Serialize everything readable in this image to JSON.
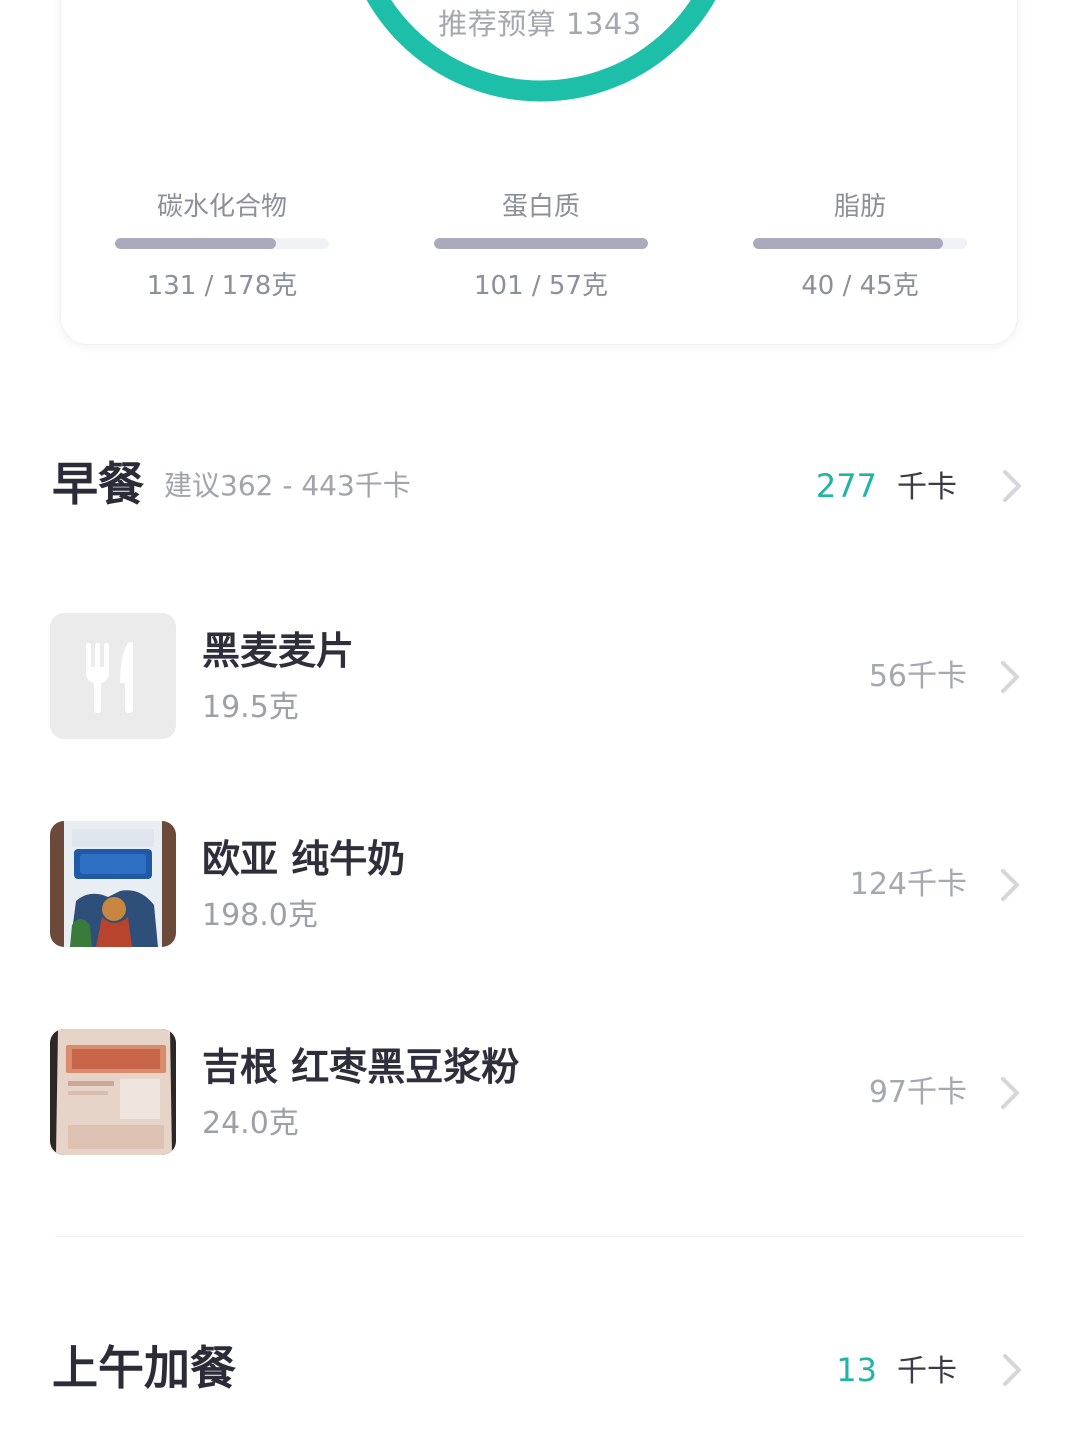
{
  "summary": {
    "budget_label": "推荐预算 1343",
    "ring_color": "#1dbfa9",
    "macros": [
      {
        "label": "碳水化合物",
        "value": "131 / 178克",
        "fill_fraction": 0.75
      },
      {
        "label": "蛋白质",
        "value": "101 / 57克",
        "fill_fraction": 1.0
      },
      {
        "label": "脂肪",
        "value": "40 / 45克",
        "fill_fraction": 0.89
      }
    ]
  },
  "breakfast": {
    "title": "早餐",
    "suggestion": "建议362 - 443千卡",
    "calories": "277",
    "unit": "千卡",
    "items": [
      {
        "name": "黑麦麦片",
        "weight": "19.5克",
        "calories": "56千卡",
        "icon": "utensils-icon"
      },
      {
        "name": "欧亚 纯牛奶",
        "weight": "198.0克",
        "calories": "124千卡",
        "icon": "milk-package-photo"
      },
      {
        "name": "吉根 红枣黑豆浆粉",
        "weight": "24.0克",
        "calories": "97千卡",
        "icon": "soy-powder-package-photo"
      }
    ]
  },
  "morning_snack": {
    "title": "上午加餐",
    "calories": "13",
    "unit": "千卡"
  },
  "colors": {
    "accent": "#1fb5a5",
    "bar_fill": "#a9abbc",
    "bar_track": "#f1f2f6"
  }
}
